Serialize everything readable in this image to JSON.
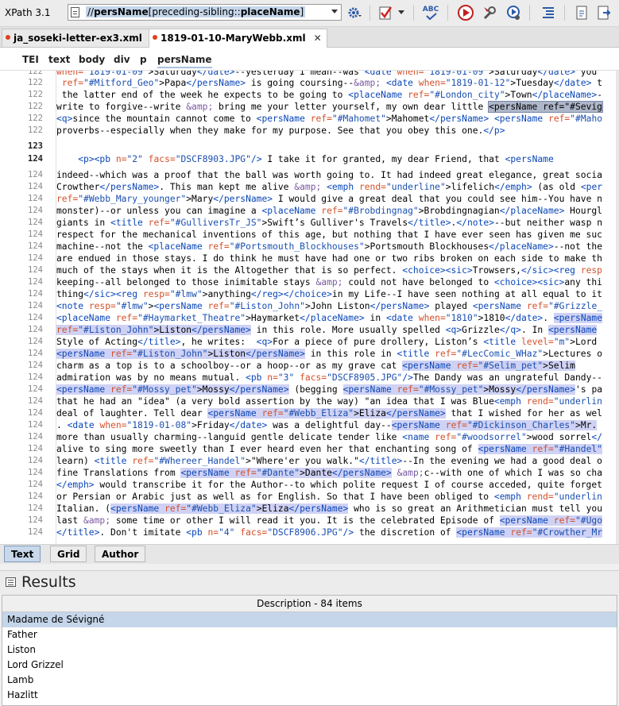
{
  "toolbar": {
    "xpath_label": "XPath 3.1",
    "xpath_expr_prefix": "//",
    "xpath_expr_name": "persName",
    "xpath_expr_predicate": "[preceding-sibling::",
    "xpath_expr_place": "placeName",
    "xpath_expr_end": "]",
    "spell_label": "ABC"
  },
  "tabs": [
    {
      "label": "ja_soseki-letter-ex3.xml",
      "active": false
    },
    {
      "label": "1819-01-10-MaryWebb.xml",
      "active": true
    }
  ],
  "tab_close": "✕",
  "breadcrumb": [
    "TEI",
    "text",
    "body",
    "div",
    "p",
    "persName"
  ],
  "lines": [
    {
      "n": "122",
      "html": "<span class=\"at\">when=</span><span class=\"vl\">\"1819-01-09\"</span>&gt;Saturday<span class=\"tg\">&lt;/date&gt;</span>--yesterday I mean--was <span class=\"tg\">&lt;date</span> <span class=\"at\">when=</span><span class=\"vl\">\"1819-01-09\"</span>&gt;Saturday<span class=\"tg\">&lt;/date&gt;</span> you"
    },
    {
      "n": "122",
      "html": " <span class=\"at\">ref=</span><span class=\"vl\">\"#Mitford_Geo\"</span>&gt;Papa<span class=\"tg\">&lt;/persName&gt;</span> is going coursing--<span class=\"mg\">&amp;amp;</span> <span class=\"tg\">&lt;date</span> <span class=\"at\">when=</span><span class=\"vl\">\"1819-01-12\"</span>&gt;Tuesday<span class=\"tg\">&lt;/date&gt;</span> t"
    },
    {
      "n": "122",
      "html": " the latter end of the week he expects to be going to <span class=\"tg\">&lt;placeName</span> <span class=\"at\">ref=</span><span class=\"vl\">\"#London_city\"</span>&gt;Town<span class=\"tg\">&lt;/placeName&gt;</span>-"
    },
    {
      "n": "122",
      "html": "write to forgive--write <span class=\"mg\">&amp;amp;</span> bring me your letter yourself, my own dear little <span class=\"sel\">&lt;persName ref=\"#Sevig</span>"
    },
    {
      "n": "122",
      "html": "<span class=\"tg\">&lt;q&gt;</span>since the mountain cannot come to <span class=\"tg\">&lt;persName</span> <span class=\"at\">ref=</span><span class=\"vl\">\"#Mahomet\"</span>&gt;Mahomet<span class=\"tg\">&lt;/persName&gt;</span> <span class=\"tg\">&lt;persName</span> <span class=\"at\">ref=</span><span class=\"vl\">\"#Maho</span>"
    },
    {
      "n": "122",
      "html": "proverbs--especially when they make for my purpose. See that you obey this one.<span class=\"tg\">&lt;/p&gt;</span>"
    },
    {
      "n": "123",
      "html": "",
      "bold": true
    },
    {
      "n": "124",
      "html": "    <span class=\"tg\">&lt;p&gt;&lt;pb</span> <span class=\"at\">n=</span><span class=\"vl\">\"2\"</span> <span class=\"at\">facs=</span><span class=\"vl\">\"DSCF8903.JPG\"</span><span class=\"tg\">/&gt;</span> I take it for granted, my dear Friend, that <span class=\"tg\">&lt;persName</span> ",
      "bold": true
    },
    {
      "n": "124",
      "html": "indeed--which was a proof that the ball was worth going to. It had indeed great elegance, great socia"
    },
    {
      "n": "124",
      "html": "Crowther<span class=\"tg\">&lt;/persName&gt;</span>. This man kept me alive <span class=\"mg\">&amp;amp;</span> <span class=\"tg\">&lt;emph</span> <span class=\"at\">rend=</span><span class=\"vl\">\"underline\"</span>&gt;lifelich<span class=\"tg\">&lt;/emph&gt;</span> (as old <span class=\"tg\">&lt;per</span>"
    },
    {
      "n": "124",
      "html": "<span class=\"at\">ref=</span><span class=\"vl\">\"#Webb_Mary_younger\"</span>&gt;Mary<span class=\"tg\">&lt;/persName&gt;</span> I would give a great deal that you could see him--You have n"
    },
    {
      "n": "124",
      "html": "monster)--or unless you can imagine a <span class=\"tg\">&lt;placeName</span> <span class=\"at\">ref=</span><span class=\"vl\">\"#Brobdingnag\"</span>&gt;Brobdingnagian<span class=\"tg\">&lt;/placeName&gt;</span> Hourgl"
    },
    {
      "n": "124",
      "html": "giants in <span class=\"tg\">&lt;title</span> <span class=\"at\">ref=</span><span class=\"vl\">\"#GulliversTr_JS\"</span>&gt;Swift’s Gulliver's Travels<span class=\"tg\">&lt;/title&gt;</span>.<span class=\"tg\">&lt;/note&gt;</span>--but neither wasp n"
    },
    {
      "n": "124",
      "html": "respect for the mechanical inventions of this age, but nothing that I have ever seen has given me suc"
    },
    {
      "n": "124",
      "html": "machine--not the <span class=\"tg\">&lt;placeName</span> <span class=\"at\">ref=</span><span class=\"vl\">\"#Portsmouth_Blockhouses\"</span>&gt;Portsmouth Blockhouses<span class=\"tg\">&lt;/placeName&gt;</span>--not the"
    },
    {
      "n": "124",
      "html": "are endued in those stays. I do think he must have had one or two ribs broken on each side to make th"
    },
    {
      "n": "124",
      "html": "much of the stays when it is the Altogether that is so perfect. <span class=\"tg\">&lt;choice&gt;&lt;sic&gt;</span>Trowsers,<span class=\"tg\">&lt;/sic&gt;&lt;reg</span> <span class=\"at\">resp</span>"
    },
    {
      "n": "124",
      "html": "keeping--all belonged to those inimitable stays <span class=\"mg\">&amp;amp;</span> could not have belonged to <span class=\"tg\">&lt;choice&gt;&lt;sic&gt;</span>any thi"
    },
    {
      "n": "124",
      "html": "thing<span class=\"tg\">&lt;/sic&gt;&lt;reg</span> <span class=\"at\">resp=</span><span class=\"vl\">\"#lmw\"</span>&gt;anything<span class=\"tg\">&lt;/reg&gt;&lt;/choice&gt;</span>in my Life--I have seen nothing at all equal to it"
    },
    {
      "n": "124",
      "html": "<span class=\"tg\">&lt;note</span> <span class=\"at\">resp=</span><span class=\"vl\">\"#lmw\"</span>&gt;<span class=\"tg\">&lt;persName</span> <span class=\"at\">ref=</span><span class=\"vl\">\"#Liston_John\"</span>&gt;John Liston<span class=\"tg\">&lt;/persName&gt;</span> played <span class=\"tg\">&lt;persName</span> <span class=\"at\">ref=</span><span class=\"vl\">\"#Grizzle_</span>"
    },
    {
      "n": "124",
      "html": "<span class=\"tg\">&lt;placeName</span> <span class=\"at\">ref=</span><span class=\"vl\">\"#Haymarket_Theatre\"</span>&gt;Haymarket<span class=\"tg\">&lt;/placeName&gt;</span> in <span class=\"tg\">&lt;date</span> <span class=\"at\">when=</span><span class=\"vl\">\"1810\"</span>&gt;1810<span class=\"tg\">&lt;/date&gt;</span>. <span class=\"pn\"><span class=\"tg\">&lt;persName</span></span>"
    },
    {
      "n": "124",
      "html": "<span class=\"pn\"><span class=\"at\">ref=</span><span class=\"vl\">\"#Liston_John\"</span>&gt;Liston<span class=\"tg\">&lt;/persName&gt;</span></span> in this role. More usually spelled <span class=\"tg\">&lt;q&gt;</span>Grizzle<span class=\"tg\">&lt;/q&gt;</span>. In <span class=\"pn\"><span class=\"tg\">&lt;persName</span></span>"
    },
    {
      "n": "124",
      "html": "Style of Acting<span class=\"tg\">&lt;/title&gt;</span>, he writes:  <span class=\"tg\">&lt;q&gt;</span>For a piece of pure drollery, Liston’s <span class=\"tg\">&lt;title</span> <span class=\"at\">level=</span><span class=\"vl\">\"m\"</span>&gt;Lord "
    },
    {
      "n": "124",
      "html": "<span class=\"pn\"><span class=\"tg\">&lt;persName</span> <span class=\"at\">ref=</span><span class=\"vl\">\"#Liston_John\"</span>&gt;Liston<span class=\"tg\">&lt;/persName&gt;</span></span> in this role in <span class=\"tg\">&lt;title</span> <span class=\"at\">ref=</span><span class=\"vl\">\"#LecComic_WHaz\"</span>&gt;Lectures o"
    },
    {
      "n": "124",
      "html": "charm as a top is to a schoolboy--or a hoop--or as my grave cat <span class=\"pn\"><span class=\"tg\">&lt;persName</span> <span class=\"at\">ref=</span><span class=\"vl\">\"#Selim_pet\"</span>&gt;Selim</span>"
    },
    {
      "n": "124",
      "html": "admiration was by no means mutual. <span class=\"tg\">&lt;pb</span> <span class=\"at\">n=</span><span class=\"vl\">\"3\"</span> <span class=\"at\">facs=</span><span class=\"vl\">\"DSCF8905.JPG\"</span><span class=\"tg\">/&gt;</span>The Dandy was an ungrateful Dandy--"
    },
    {
      "n": "124",
      "html": "<span class=\"pn\"><span class=\"tg\">&lt;persName</span> <span class=\"at\">ref=</span><span class=\"vl\">\"#Mossy_pet\"</span>&gt;Mossy<span class=\"tg\">&lt;/persName&gt;</span></span> (begging <span class=\"pn\"><span class=\"tg\">&lt;persName</span> <span class=\"at\">ref=</span><span class=\"vl\">\"#Mossy_pet\"</span>&gt;Mossy<span class=\"tg\">&lt;/persName&gt;</span></span>'s pa"
    },
    {
      "n": "124",
      "html": "that he had an \"idea\" (a very bold assertion by the way) \"an idea that I was Blue<span class=\"tg\">&lt;emph</span> <span class=\"at\">rend=</span><span class=\"vl\">\"underlin</span>"
    },
    {
      "n": "124",
      "html": "deal of laughter. Tell dear <span class=\"pn\"><span class=\"tg\">&lt;persName</span> <span class=\"at\">ref=</span><span class=\"vl\">\"#Webb_Eliza\"</span>&gt;Eliza<span class=\"tg\">&lt;/persName&gt;</span></span> that I wished for her as wel"
    },
    {
      "n": "124",
      "html": ". <span class=\"tg\">&lt;date</span> <span class=\"at\">when=</span><span class=\"vl\">\"1819-01-08\"</span>&gt;Friday<span class=\"tg\">&lt;/date&gt;</span> was a delightful day--<span class=\"pn\"><span class=\"tg\">&lt;persName</span> <span class=\"at\">ref=</span><span class=\"vl\">\"#Dickinson_Charles\"</span>&gt;Mr.</span>"
    },
    {
      "n": "124",
      "html": "more than usually charming--languid gentle delicate tender like <span class=\"tg\">&lt;name</span> <span class=\"at\">ref=</span><span class=\"vl\">\"#woodsorrel\"</span>&gt;wood sorrel<span class=\"tg\">&lt;/</span>"
    },
    {
      "n": "124",
      "html": "alive to sing more sweetly than I ever heard even her that enchanting song of <span class=\"pn\"><span class=\"tg\">&lt;persName</span> <span class=\"at\">ref=</span><span class=\"vl\">\"#Handel\"</span></span>"
    },
    {
      "n": "124",
      "html": "learn) <span class=\"tg\">&lt;title</span> <span class=\"at\">ref=</span><span class=\"vl\">\"#Whereer_Handel\"</span>&gt;\"Where'er you walk.\"<span class=\"tg\">&lt;/title&gt;</span>--In the evening we had a good deal o"
    },
    {
      "n": "124",
      "html": "fine Translations from <span class=\"pn\"><span class=\"tg\">&lt;persName</span> <span class=\"at\">ref=</span><span class=\"vl\">\"#Dante\"</span>&gt;Dante<span class=\"tg\">&lt;/persName&gt;</span></span> <span class=\"mg\">&amp;amp;</span>c--with one of which I was so cha"
    },
    {
      "n": "124",
      "html": "<span class=\"tg\">&lt;/emph&gt;</span> would transcribe it for the Author--to which polite request I of course acceded, quite forget"
    },
    {
      "n": "124",
      "html": "or Persian or Arabic just as well as for English. So that I have been obliged to <span class=\"tg\">&lt;emph</span> <span class=\"at\">rend=</span><span class=\"vl\">\"underlin</span>"
    },
    {
      "n": "124",
      "html": "Italian. (<span class=\"pn\"><span class=\"tg\">&lt;persName</span> <span class=\"at\">ref=</span><span class=\"vl\">\"#Webb_Eliza\"</span>&gt;Eliza<span class=\"tg\">&lt;/persName&gt;</span></span> who is so great an Arithmetician must tell you"
    },
    {
      "n": "124",
      "html": "last <span class=\"mg\">&amp;amp;</span> some time or other I will read it you. It is the celebrated Episode of <span class=\"pn\"><span class=\"tg\">&lt;persName</span> <span class=\"at\">ref=</span><span class=\"vl\">\"#Ugo</span></span>"
    },
    {
      "n": "124",
      "html": "<span class=\"tg\">&lt;/title&gt;</span>. Don't imitate <span class=\"tg\">&lt;pb</span> <span class=\"at\">n=</span><span class=\"vl\">\"4\"</span> <span class=\"at\">facs=</span><span class=\"vl\">\"DSCF8906.JPG\"</span><span class=\"tg\">/&gt;</span> the discretion of <span class=\"pn\"><span class=\"tg\">&lt;persName</span> <span class=\"at\">ref=</span><span class=\"vl\">\"#Crowther_Mr</span></span>"
    }
  ],
  "modes": [
    "Text",
    "Grid",
    "Author"
  ],
  "results": {
    "title": "Results",
    "header": "Description - 84 items",
    "rows": [
      "Madame de Sévigné",
      "Father",
      "Liston",
      "Lord Grizzel",
      "Lamb",
      "Hazlitt"
    ]
  },
  "colors": {
    "tag": "#0a46b8",
    "attr": "#d4502a",
    "value": "#1a4fb0",
    "highlight": "#cfd2f4",
    "selection": "#c5d6ea"
  }
}
